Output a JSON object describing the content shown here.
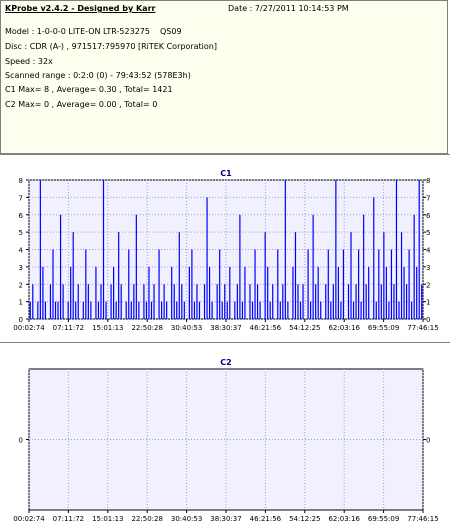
{
  "header": {
    "title": "KProbe v2.4.2 - Designed by Karr",
    "date": "Date : 7/27/2011 10:14:53 PM",
    "model": "Model : 1-0-0-0 LITE-ON LTR-523275",
    "model_code": "QS09",
    "disc": "Disc : CDR (A-) , 971517:795970 [RiTEK Corporation]",
    "speed": "Speed : 32x",
    "scanned_range": "Scanned range : 0:2:0 (0) - 79:43:52 (578E3h)",
    "c1_stats": "C1 Max= 8 , Average= 0.30 , Total= 1421",
    "c2_stats": "C2 Max= 0 , Average= 0.00 , Total= 0"
  },
  "colors": {
    "bar": "#0000ff",
    "plot_bg": "#f0f0ff",
    "info_bg": "#ffffef",
    "title": "#000080"
  },
  "chart_data": [
    {
      "type": "bar",
      "title": "C1",
      "ylim": [
        0,
        8
      ],
      "yticks": [
        "0",
        "1",
        "2",
        "3",
        "4",
        "5",
        "6",
        "7",
        "8"
      ],
      "xticks": [
        "00:02:74",
        "07:11:72",
        "15:01:13",
        "22:50:28",
        "30:40:53",
        "38:30:37",
        "46:21:56",
        "54:12:25",
        "62:03:16",
        "69:55:09",
        "77:46:15"
      ],
      "grid": true,
      "values": [
        1,
        2,
        0,
        1,
        8,
        3,
        1,
        0,
        2,
        4,
        1,
        1,
        6,
        2,
        0,
        1,
        3,
        5,
        1,
        2,
        0,
        1,
        4,
        2,
        1,
        0,
        3,
        1,
        2,
        8,
        1,
        0,
        2,
        3,
        1,
        5,
        2,
        0,
        1,
        4,
        1,
        2,
        6,
        1,
        0,
        2,
        1,
        3,
        1,
        2,
        0,
        4,
        1,
        2,
        1,
        0,
        3,
        2,
        1,
        5,
        2,
        1,
        0,
        3,
        4,
        1,
        2,
        1,
        0,
        2,
        7,
        3,
        1,
        0,
        2,
        4,
        1,
        2,
        1,
        3,
        0,
        1,
        2,
        6,
        1,
        3,
        0,
        2,
        1,
        4,
        2,
        1,
        0,
        5,
        3,
        1,
        2,
        0,
        4,
        1,
        2,
        8,
        1,
        0,
        3,
        5,
        2,
        1,
        2,
        0,
        4,
        1,
        6,
        2,
        3,
        1,
        0,
        2,
        4,
        1,
        2,
        8,
        3,
        1,
        4,
        0,
        2,
        5,
        1,
        2,
        4,
        1,
        6,
        2,
        3,
        0,
        7,
        1,
        4,
        2,
        5,
        3,
        1,
        4,
        2,
        8,
        1,
        5,
        3,
        2,
        4,
        1,
        6,
        3,
        8,
        2
      ]
    },
    {
      "type": "bar",
      "title": "C2",
      "ylim": [
        0,
        1
      ],
      "yticks": [
        "0"
      ],
      "xticks": [
        "00:02:74",
        "07:11:72",
        "15:01:13",
        "22:50:28",
        "30:40:53",
        "38:30:37",
        "46:21:56",
        "54:12:25",
        "62:03:16",
        "69:55:09",
        "77:46:15"
      ],
      "grid": true,
      "values": []
    }
  ]
}
